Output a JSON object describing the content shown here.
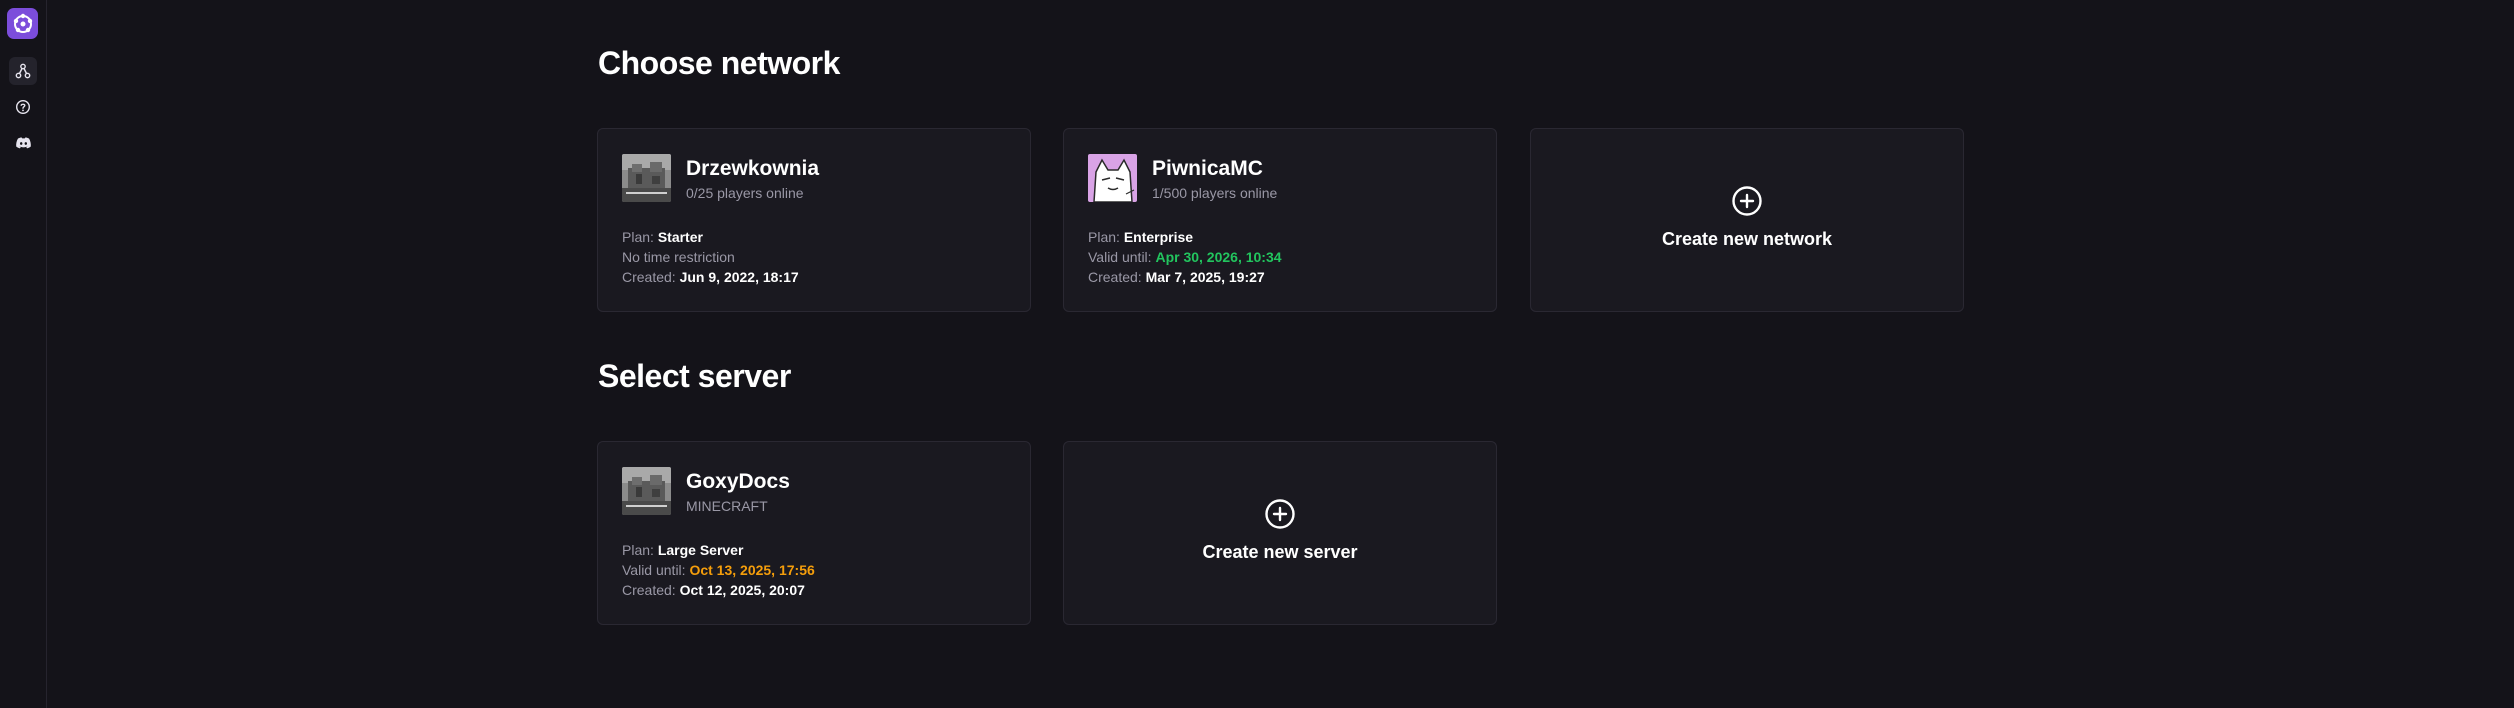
{
  "sidebar": {
    "items": [
      {
        "icon": "network-icon",
        "active": true
      },
      {
        "icon": "help-icon",
        "active": false
      },
      {
        "icon": "discord-icon",
        "active": false
      }
    ]
  },
  "networks_section": {
    "title": "Choose network",
    "cards": [
      {
        "name": "Drzewkownia",
        "subtitle": "0/25 players online",
        "plan_label": "Plan:",
        "plan": "Starter",
        "validity_text": "No time restriction",
        "created_label": "Created:",
        "created": "Jun 9, 2022, 18:17"
      },
      {
        "name": "PiwnicaMC",
        "subtitle": "1/500 players online",
        "plan_label": "Plan:",
        "plan": "Enterprise",
        "valid_label": "Valid until:",
        "valid_until": "Apr 30, 2026, 10:34",
        "created_label": "Created:",
        "created": "Mar 7, 2025, 19:27"
      }
    ],
    "create_label": "Create new network"
  },
  "servers_section": {
    "title": "Select server",
    "cards": [
      {
        "name": "GoxyDocs",
        "subtitle": "MINECRAFT",
        "plan_label": "Plan:",
        "plan": "Large Server",
        "valid_label": "Valid until:",
        "valid_until": "Oct 13, 2025, 17:56",
        "created_label": "Created:",
        "created": "Oct 12, 2025, 20:07"
      }
    ],
    "create_label": "Create new server"
  },
  "colors": {
    "background": "#141319",
    "card": "#1a1920",
    "accent": "#7c4ddb",
    "valid_green": "#22c55e",
    "valid_orange": "#f59e0b"
  }
}
